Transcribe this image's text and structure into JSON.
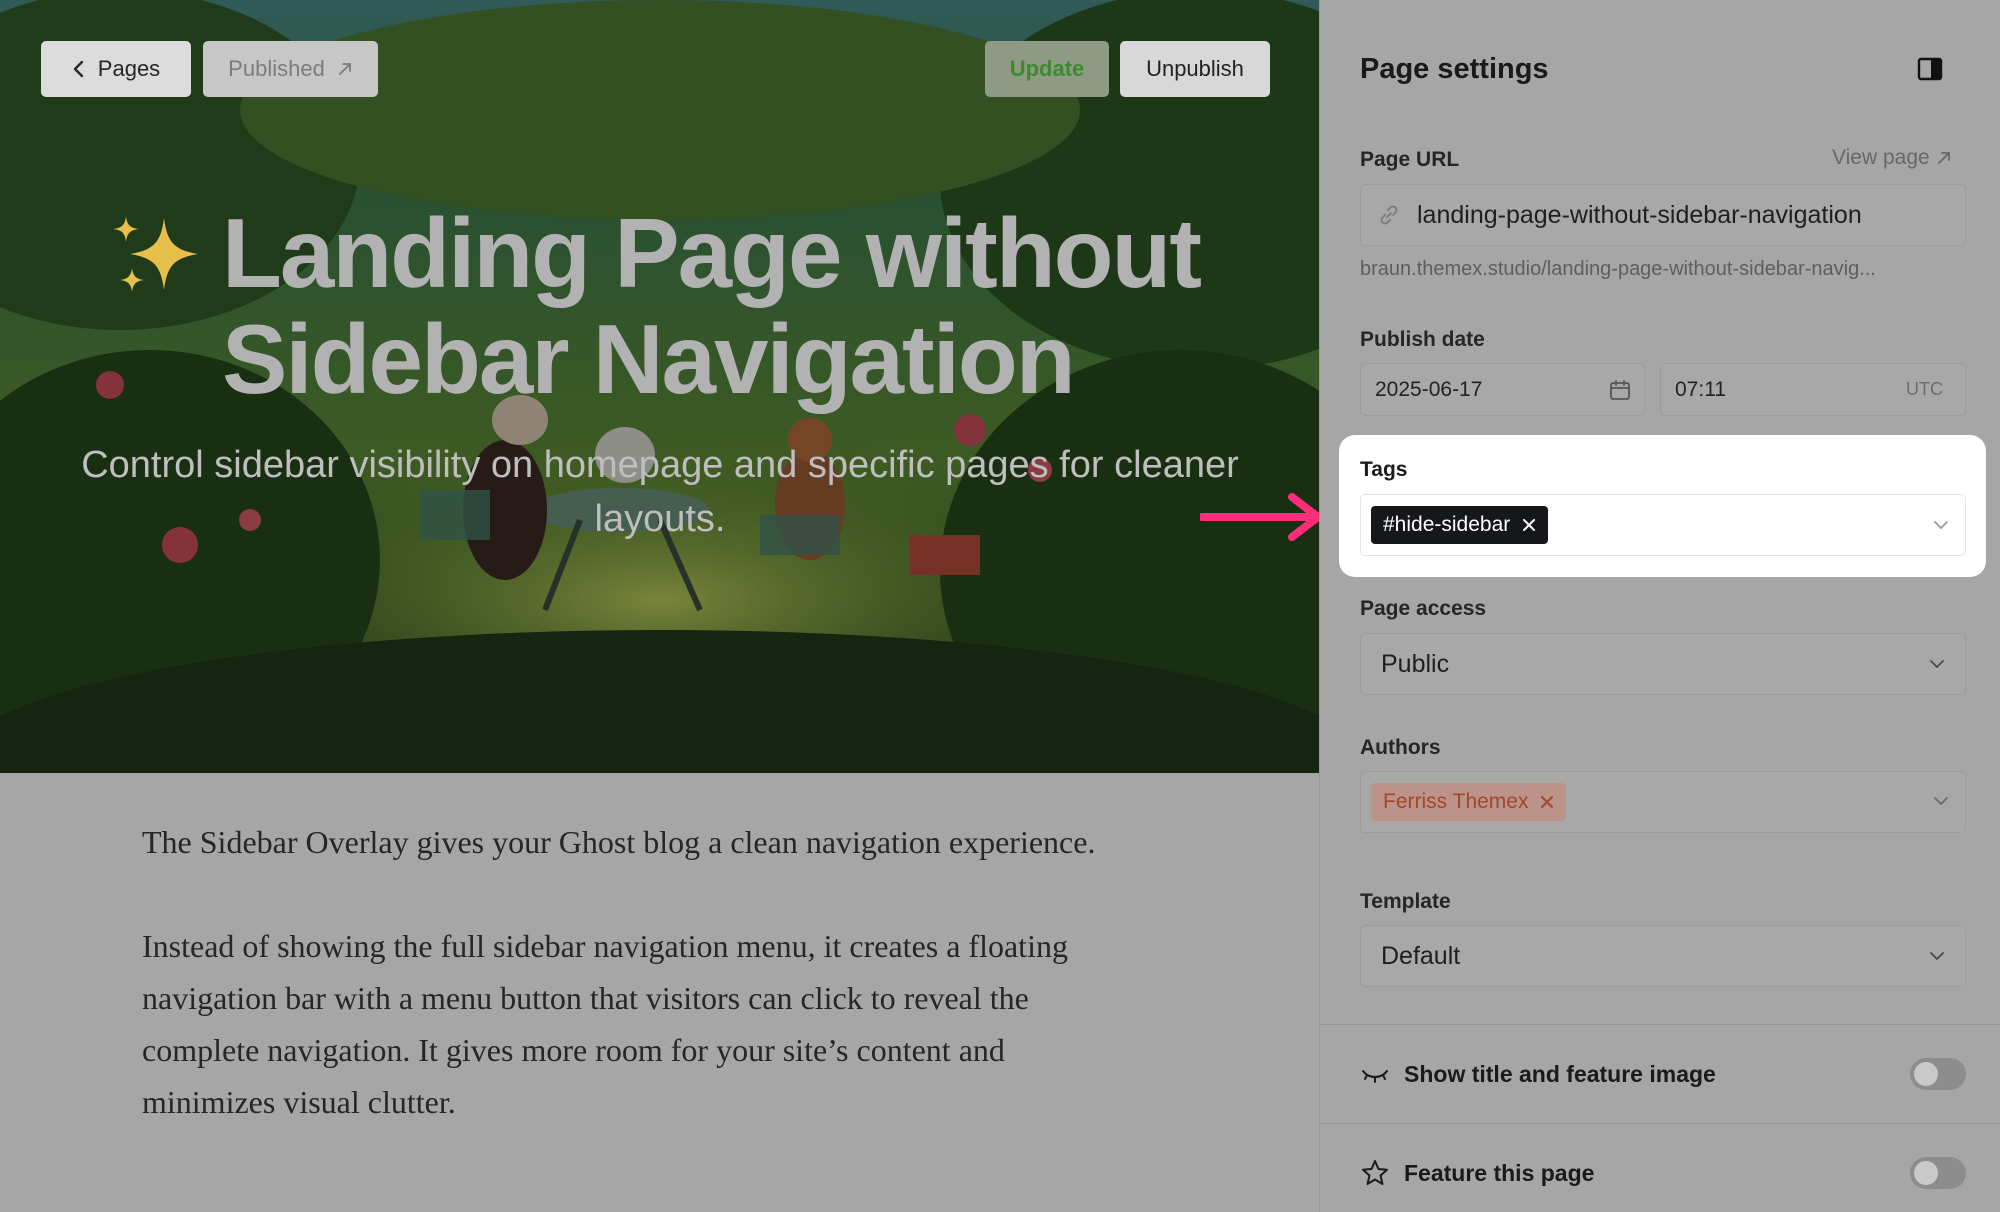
{
  "editor": {
    "back_label": "Pages",
    "published_label": "Published",
    "update_label": "Update",
    "unpublish_label": "Unpublish",
    "title": "Landing Page without Sidebar Navigation",
    "subtitle": "Control sidebar visibility on homepage and specific pages for cleaner layouts.",
    "paragraphs": [
      "The Sidebar Overlay gives your Ghost blog a clean navigation experience.",
      "Instead of showing the full sidebar navigation menu, it creates a floating navigation bar with a menu button that visitors can click to reveal the complete navigation. It gives more room for your site’s content and minimizes visual clutter."
    ]
  },
  "settings": {
    "title": "Page settings",
    "page_url": {
      "label": "Page URL",
      "view_page": "View page",
      "value": "landing-page-without-sidebar-navigation",
      "hint": "braun.themex.studio/landing-page-without-sidebar-navig..."
    },
    "publish_date": {
      "label": "Publish date",
      "date": "2025-06-17",
      "time": "07:11",
      "timezone": "UTC"
    },
    "tags": {
      "label": "Tags",
      "items": [
        "#hide-sidebar"
      ]
    },
    "page_access": {
      "label": "Page access",
      "value": "Public"
    },
    "authors": {
      "label": "Authors",
      "items": [
        "Ferriss Themex"
      ]
    },
    "template": {
      "label": "Template",
      "value": "Default"
    },
    "toggles": [
      {
        "label": "Show title and feature image",
        "icon": "eye-closed-icon",
        "on": false
      },
      {
        "label": "Feature this page",
        "icon": "star-icon",
        "on": false
      }
    ]
  },
  "colors": {
    "accent_update": "#3d8a2f",
    "tag_chip_bg": "#15171a",
    "author_chip_text": "#a3472b",
    "arrow": "#ff2d7a",
    "overlay": "#a6a6a6"
  }
}
